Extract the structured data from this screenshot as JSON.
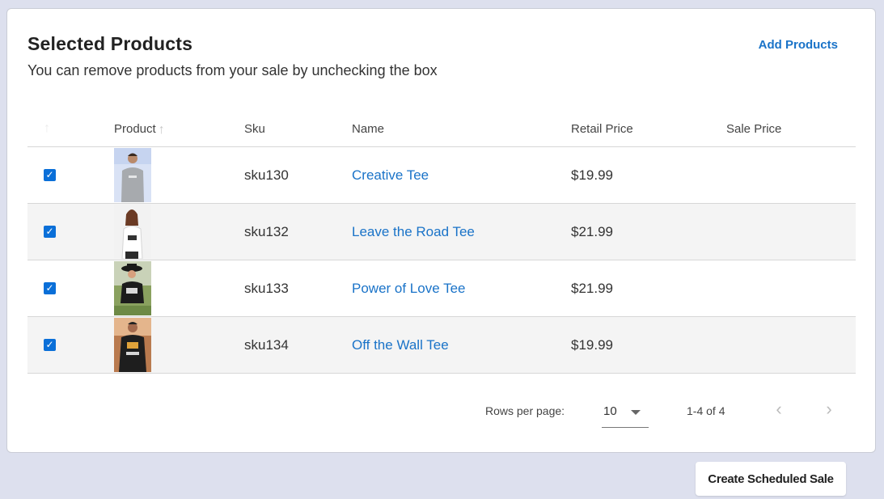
{
  "card": {
    "title": "Selected Products",
    "subtitle": "You can remove products from your sale by unchecking the box",
    "add_products_label": "Add Products"
  },
  "table": {
    "headers": {
      "product": "Product",
      "sku": "Sku",
      "name": "Name",
      "retail_price": "Retail Price",
      "sale_price": "Sale Price"
    },
    "rows": [
      {
        "checked": true,
        "thumbnail": "product-photo-man-grey-tee",
        "sku": "sku130",
        "name": "Creative Tee",
        "retail_price": "$19.99",
        "sale_price": ""
      },
      {
        "checked": true,
        "thumbnail": "product-photo-woman-white-tee",
        "sku": "sku132",
        "name": "Leave the Road Tee",
        "retail_price": "$21.99",
        "sale_price": ""
      },
      {
        "checked": true,
        "thumbnail": "product-photo-woman-black-tee-hat",
        "sku": "sku133",
        "name": "Power of Love Tee",
        "retail_price": "$21.99",
        "sale_price": ""
      },
      {
        "checked": true,
        "thumbnail": "product-photo-man-black-tee",
        "sku": "sku134",
        "name": "Off the Wall Tee",
        "retail_price": "$19.99",
        "sale_price": ""
      }
    ]
  },
  "pagination": {
    "rows_per_page_label": "Rows per page:",
    "rows_per_page_value": "10",
    "range_label": "1-4 of 4"
  },
  "actions": {
    "create_label": "Create Scheduled Sale"
  },
  "colors": {
    "background": "#dde0ee",
    "link": "#1a73c8",
    "checkbox": "#0a6fd8"
  }
}
